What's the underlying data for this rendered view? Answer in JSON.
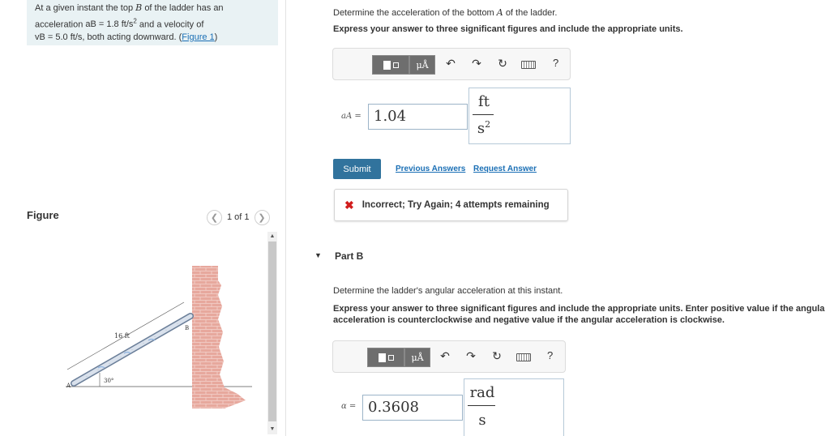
{
  "problem": {
    "line1": "At a given instant the top",
    "line1_var": "B",
    "line1_end": "of the ladder has an",
    "line2_start": "acceleration",
    "line2_math": "aB = 1.8 ft/s",
    "line2_end": "and a velocity of",
    "line3_math": "vB = 5.0 ft/s",
    "line3_end": ", both acting downward. (",
    "figure_link": "Figure 1",
    "line3_close": ")"
  },
  "figure": {
    "label": "Figure",
    "pager": "1 of 1",
    "length_label": "16 ft",
    "angle_label": "30°",
    "point_a": "A",
    "point_b": "B"
  },
  "part_a": {
    "question": "Determine the acceleration of the bottom",
    "question_var": "A",
    "question_end": "of the ladder.",
    "instruction": "Express your answer to three significant figures and include the appropriate units.",
    "var_label": "aA =",
    "value": "1.04",
    "unit_num": "ft",
    "unit_den": "s",
    "unit_exp": "2",
    "submit": "Submit",
    "previous_answers": "Previous Answers",
    "request_answer": "Request Answer",
    "feedback": "Incorrect; Try Again; 4 attempts remaining"
  },
  "part_b": {
    "title": "Part B",
    "question": "Determine the ladder's angular acceleration at this instant.",
    "instruction_line1": "Express your answer to three significant figures and include the appropriate units. Enter positive value if the angula",
    "instruction_line2": "acceleration is counterclockwise and negative value if the angular acceleration is clockwise.",
    "var_label": "α =",
    "value": "0.3608",
    "unit_num": "rad",
    "unit_den": "s"
  },
  "toolbar": {
    "mu_label": "μÅ",
    "help": "?"
  },
  "colors": {
    "problem_bg": "#e9f2f4",
    "submit_bg": "#31739d",
    "link": "#1a6fb5",
    "error": "#d11d1d"
  }
}
